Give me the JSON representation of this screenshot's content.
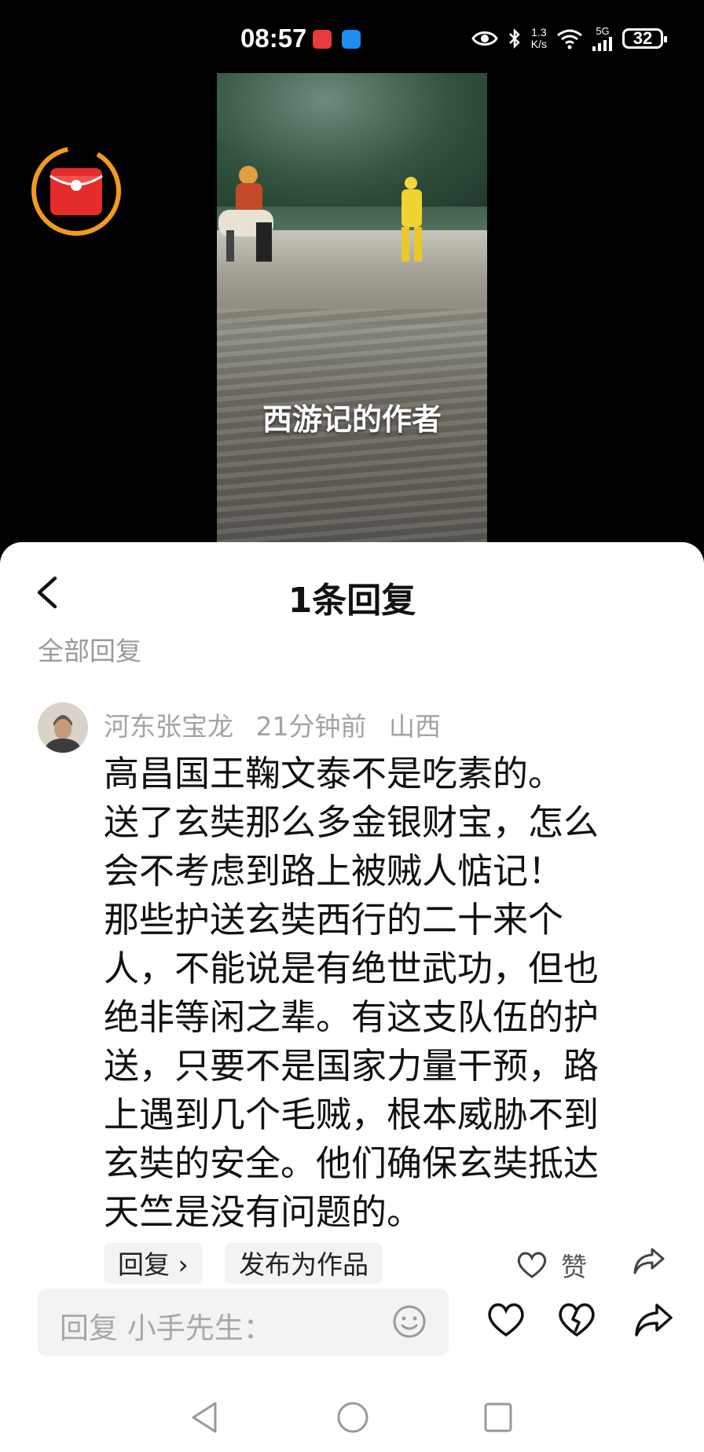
{
  "status_bar": {
    "time": "08:57",
    "net_speed_value": "1.3",
    "net_speed_unit": "K/s",
    "network": "5G",
    "battery": "32"
  },
  "video": {
    "caption": "西游记的作者"
  },
  "sheet": {
    "title": "1条回复",
    "all_replies": "全部回复"
  },
  "comment": {
    "author": "河东张宝龙",
    "time": "21分钟前",
    "location": "山西",
    "lines": [
      "高昌国王鞠文泰不是吃素的。",
      "送了玄奘那么多金银财宝，怎么",
      "会不考虑到路上被贼人惦记！",
      "那些护送玄奘西行的二十来个",
      "人，不能说是有绝世武功，但也",
      "绝非等闲之辈。有这支队伍的护",
      "送，只要不是国家力量干预，路",
      "上遇到几个毛贼，根本威胁不到",
      "玄奘的安全。他们确保玄奘抵达",
      "天竺是没有问题的。"
    ],
    "reply_button": "回复 ›",
    "publish_button": "发布为作品",
    "like_label": "赞"
  },
  "input": {
    "placeholder": "回复 小手先生："
  },
  "colors": {
    "accent_orange": "#f39a1e",
    "red_packet": "#e62b2b",
    "muted_text": "#a3a3a3"
  }
}
